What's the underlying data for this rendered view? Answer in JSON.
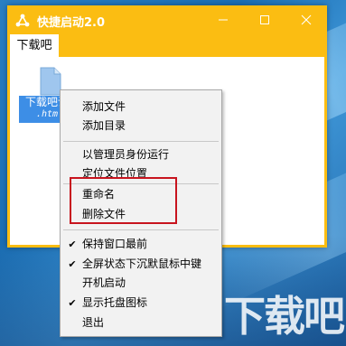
{
  "window": {
    "title": "快捷启动2.0",
    "accent": "#fbbd12",
    "tab": "下载吧"
  },
  "file": {
    "name_line1": "下载吧说",
    "name_line2": ".htm"
  },
  "menu": {
    "items": [
      {
        "label": "添加文件",
        "checked": false
      },
      {
        "label": "添加目录",
        "checked": false
      },
      {
        "label": "以管理员身份运行",
        "checked": false
      },
      {
        "label": "定位文件位置",
        "checked": false
      },
      {
        "label": "重命名",
        "checked": false
      },
      {
        "label": "删除文件",
        "checked": false
      },
      {
        "label": "保持窗口最前",
        "checked": true
      },
      {
        "label": "全屏状态下沉默鼠标中键",
        "checked": true
      },
      {
        "label": "开机启动",
        "checked": false
      },
      {
        "label": "显示托盘图标",
        "checked": true
      },
      {
        "label": "退出",
        "checked": false
      }
    ],
    "highlight_color": "#c8141e"
  },
  "watermark": "下载吧"
}
